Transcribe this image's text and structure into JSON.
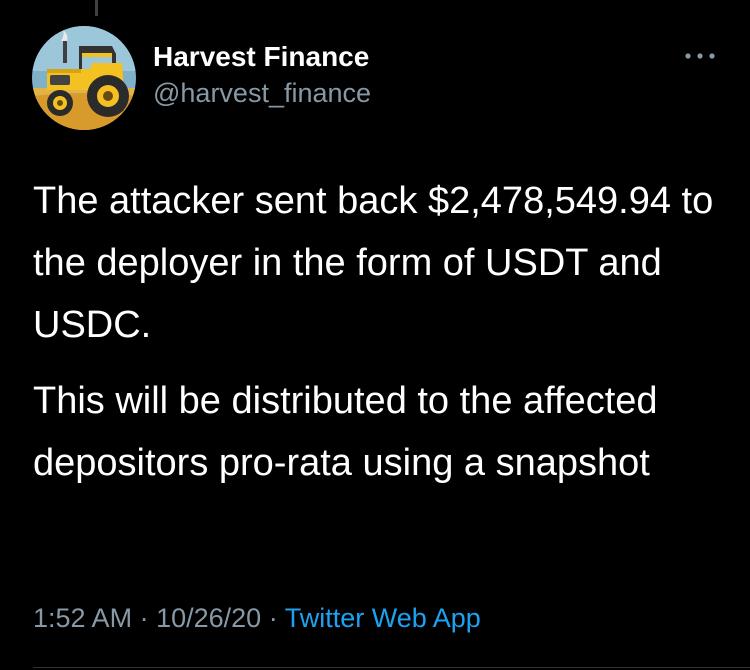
{
  "tweet": {
    "author": {
      "display_name": "Harvest Finance",
      "handle": "@harvest_finance",
      "avatar_icon": "tractor-icon"
    },
    "more_icon": "more-horizontal-icon",
    "paragraphs": [
      "The attacker sent back $2,478,549.94 to the deployer in the form of USDT and USDC.",
      "This will be distributed to the affected depositors pro-rata using a snapshot"
    ],
    "meta": {
      "time": "1:52 AM",
      "separator": "·",
      "date": "10/26/20",
      "source": "Twitter Web App"
    }
  },
  "colors": {
    "background": "#000000",
    "primary_text": "#ffffff",
    "secondary_text": "#8899a6",
    "link": "#1da1f2"
  }
}
